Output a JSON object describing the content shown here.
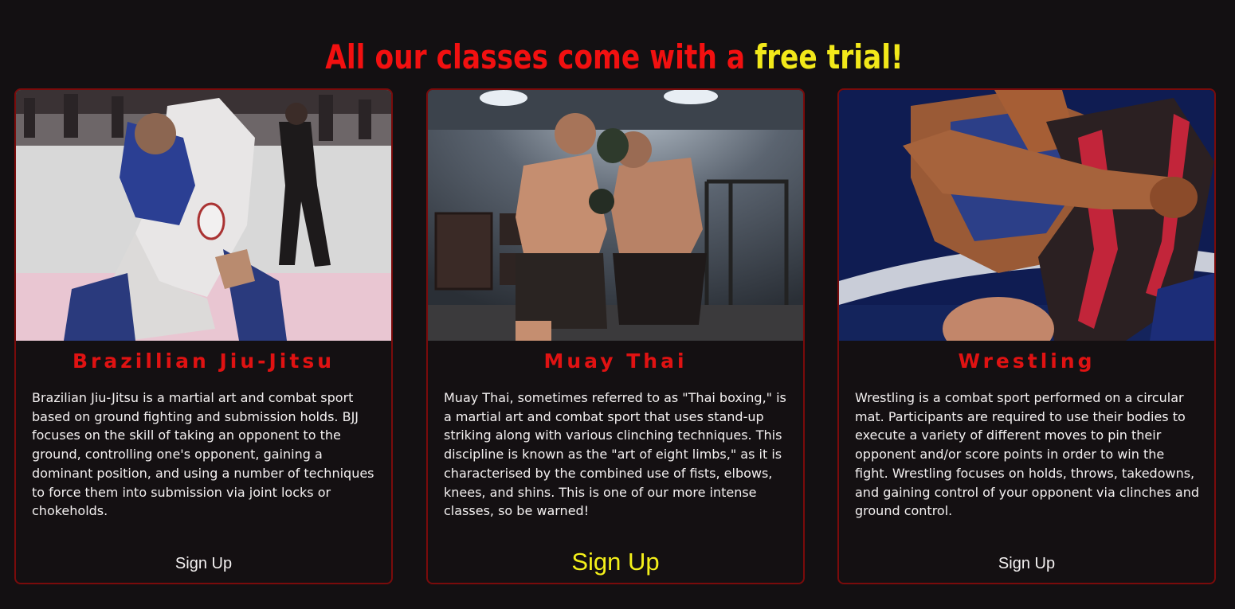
{
  "heading": {
    "prefix": "All our classes come with a ",
    "highlight": "free trial!"
  },
  "colors": {
    "background": "#131012",
    "accent_red": "#e01212",
    "accent_yellow": "#f4f01a",
    "card_border": "#7a0b0b",
    "text": "#f4f1f1"
  },
  "cards": [
    {
      "title": "Brazillian Jiu-Jitsu",
      "image": "bjj-photo",
      "description": "Brazilian Jiu-Jitsu is a martial art and combat sport based on ground fighting and submission holds. BJJ focuses on the skill of taking an opponent to the ground, controlling one's opponent, gaining a dominant position, and using a number of techniques to force them into submission via joint locks or chokeholds.",
      "signup_label": "Sign Up"
    },
    {
      "title": "Muay Thai",
      "image": "muay-thai-photo",
      "description": "Muay Thai, sometimes referred to as \"Thai boxing,\" is a martial art and combat sport that uses stand-up striking along with various clinching techniques. This discipline is known as the \"art of eight limbs,\" as it is characterised by the combined use of fists, elbows, knees, and shins. This is one of our more intense classes, so be warned!",
      "signup_label": "Sign Up"
    },
    {
      "title": "Wrestling",
      "image": "wrestling-photo",
      "description": "Wrestling is a combat sport performed on a circular mat. Participants are required to use their bodies to execute a variety of different moves to pin their opponent and/or score points in order to win the fight. Wrestling focuses on holds, throws, takedowns, and gaining control of your opponent via clinches and ground control.",
      "signup_label": "Sign Up"
    }
  ]
}
